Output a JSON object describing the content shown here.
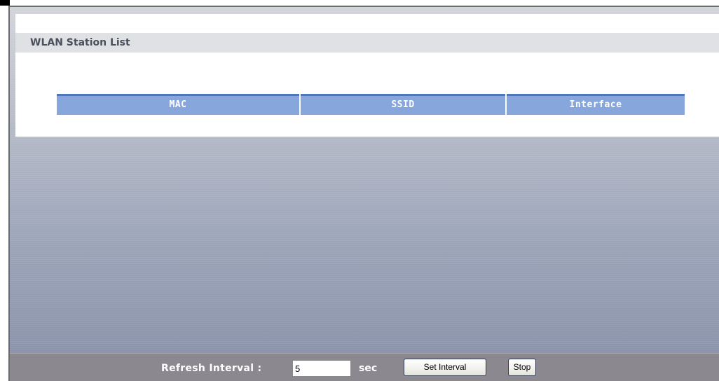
{
  "station_list": {
    "title": "WLAN Station List",
    "columns": [
      "MAC",
      "SSID",
      "Interface"
    ],
    "rows": []
  },
  "footer": {
    "refresh_label": "Refresh Interval :",
    "refresh_value": "5",
    "unit": "sec",
    "set_interval_label": "Set Interval",
    "stop_label": "Stop"
  },
  "colors": {
    "table_header": "#86a6dc",
    "table_header_top": "#4f77b8",
    "section_title_bg": "#dfe1e4",
    "footer_bg": "#8b8890"
  }
}
